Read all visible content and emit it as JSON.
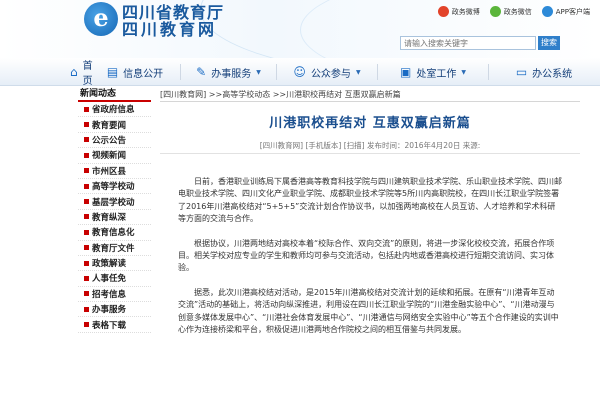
{
  "header": {
    "logo_letter": "e",
    "site_name_1": "四川省教育厅",
    "site_name_2": "四川教育网",
    "links": [
      {
        "label": "政务微博",
        "icon": "weibo-icon",
        "color": "#e2432a"
      },
      {
        "label": "政务微信",
        "icon": "wechat-icon",
        "color": "#5bb53b"
      },
      {
        "label": "APP客户端",
        "icon": "app-icon",
        "color": "#2d8ad8"
      }
    ],
    "search_placeholder": "请输入搜索关键字",
    "search_button": "搜索"
  },
  "nav": [
    {
      "label": "首 页",
      "icon": "home-icon"
    },
    {
      "label": "信息公开",
      "icon": "document-icon"
    },
    {
      "label": "办事服务",
      "icon": "service-icon"
    },
    {
      "label": "公众参与",
      "icon": "people-icon"
    },
    {
      "label": "处室工作",
      "icon": "folder-icon"
    },
    {
      "label": "办公系统",
      "icon": "monitor-icon"
    }
  ],
  "sidebar": {
    "title": "新闻动态",
    "items": [
      "省政府信息",
      "教育要闻",
      "公示公告",
      "视频新闻",
      "市州区县",
      "高等学校动",
      "基层学校动",
      "教育纵深",
      "教育信息化",
      "教育厅文件",
      "政策解读",
      "人事任免",
      "招考信息",
      "办事服务",
      "表格下载"
    ]
  },
  "main": {
    "breadcrumb": "[四川教育网]  >>高等学校动态  >>川港职校再结对 互惠双赢启新篇",
    "title": "川港职校再结对  互惠双赢启新篇",
    "meta": "[四川教育网]  [手机版本]  [扫描]  发布时间：2016年4月20日   来源:",
    "paragraphs": [
      "日前，香港职业训练局下属香港高等教育科技学院与四川建筑职业技术学院、乐山职业技术学院、四川邮电职业技术学院、四川文化产业职业学院、成都职业技术学院等5所川内高职院校，在四川长江职业学院签署了2016年川港高校结对“5+5+5”交流计划合作协议书，以加强两地高校在人员互访、人才培养和学术科研等方面的交流与合作。",
      "根据协议，川港两地结对高校本着“校际合作、双向交流”的原则，将进一步深化校校交流，拓展合作项目。相关学校对应专业的学生和教师均可参与交流活动，包括赴内地或香港高校进行短期交流访问、实习体验。",
      "据悉，此次川港高校结对活动，是2015年川港高校结对交流计划的延续和拓展。在原有“川港青年互动交流”活动的基础上，将活动向纵深推进，利用设在四川长江职业学院的“川港金融实验中心”、“川港动漫与创意多媒体发展中心”、“川港社会体育发展中心”、“川港通信与网络安全实验中心”等五个合作建设的实训中心作为连接桥梁和平台，积极促进川港两地合作院校之间的相互借鉴与共同发展。"
    ]
  },
  "colors": {
    "accent": "#c80000",
    "brand_blue": "#1a5a9e"
  }
}
